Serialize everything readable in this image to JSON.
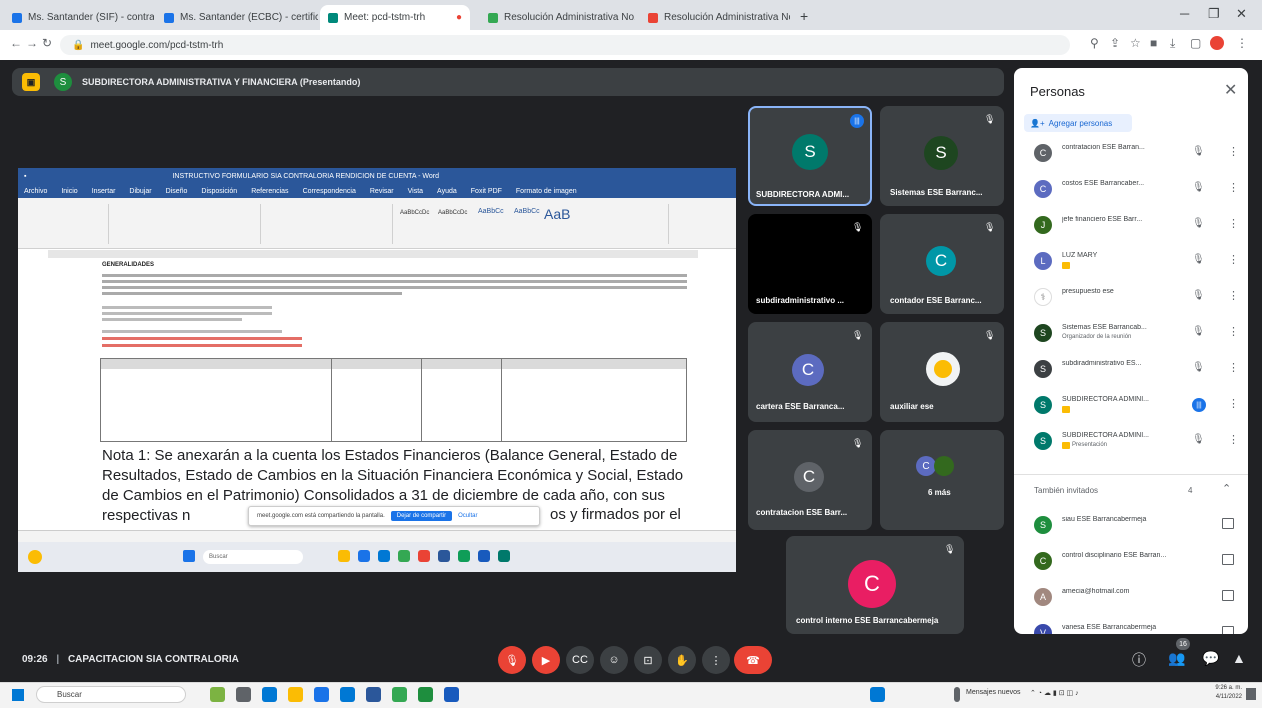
{
  "browser": {
    "tabs": [
      {
        "label": "Ms. Santander (SIF) - contralor..."
      },
      {
        "label": "Ms. Santander (ECBC) - certificado..."
      },
      {
        "label": "Meet: pcd-tstm-trh"
      },
      {
        "label": "Resolución Administrativa No..."
      },
      {
        "label": "Resolución Administrativa No..."
      }
    ],
    "url": "meet.google.com/pcd-tstm-trh"
  },
  "presentation": {
    "presenter": "SUBDIRECTORA ADMINISTRATIVA Y FINANCIERA (Presentando)"
  },
  "shared_doc": {
    "window_title": "INSTRUCTIVO FORMULARIO SIA CONTRALORIA RENDICION DE CUENTA - Word",
    "menu": [
      "Archivo",
      "Inicio",
      "Insertar",
      "Dibujar",
      "Diseño",
      "Disposición",
      "Referencias",
      "Correspondencia",
      "Revisar",
      "Vista",
      "Ayuda",
      "Foxit PDF",
      "Formato de imagen"
    ],
    "styles": [
      "AaBbCcDc",
      "AaBbCcDc",
      "AaBbCc",
      "AaBbCc",
      "AaB"
    ],
    "heading": "GENERALIDADES",
    "note": "Nota 1: Se anexarán a la cuenta los Estados Financieros (Balance General, Estado de Resultados, Estado de Cambios en la Situación Financiera Económica y Social, Estado de Cambios en el Patrimonio) Consolidados a 31 de diciembre de cada año, con sus respectivas n",
    "note_tail": "os y firmados por el",
    "share_banner": {
      "text": "meet.google.com está compartiendo la pantalla.",
      "stop": "Dejar de compartir",
      "hide": "Ocultar"
    },
    "taskbar_search": "Buscar"
  },
  "tiles": [
    {
      "name": "SUBDIRECTORA ADMI...",
      "initial": "S"
    },
    {
      "name": "Sistemas ESE Barranc...",
      "initial": "S"
    },
    {
      "name": "subdiradministrativo ...",
      "initial": ""
    },
    {
      "name": "contador ESE Barranc...",
      "initial": "C"
    },
    {
      "name": "cartera ESE Barranca...",
      "initial": "C"
    },
    {
      "name": "auxiliar ese",
      "initial": ""
    },
    {
      "name": "contratacion ESE Barr...",
      "initial": "C"
    },
    {
      "name": "6 más",
      "initial": "C"
    },
    {
      "name": "control interno ESE Barrancabermeja",
      "initial": "C"
    }
  ],
  "people": {
    "title": "Personas",
    "add_label": "Agregar personas",
    "rows": [
      {
        "name": "contratacion ESE Barran...",
        "initial": "C",
        "color": "#5f6368"
      },
      {
        "name": "costos ESE Barrancaber...",
        "initial": "C",
        "color": "#5c6bc0"
      },
      {
        "name": "jefe financiero ESE Barr...",
        "initial": "J",
        "color": "#33691e"
      },
      {
        "name": "LUZ MARY",
        "initial": "L",
        "color": "#5c6bc0"
      },
      {
        "name": "presupuesto ese",
        "initial": "",
        "color": "#ffffff"
      },
      {
        "name": "Sistemas ESE Barrancab...",
        "sub": "Organizador de la reunión",
        "initial": "S",
        "color": "#1e4620"
      },
      {
        "name": "subdiradministrativo ES...",
        "initial": "S",
        "color": "#3c4043"
      },
      {
        "name": "SUBDIRECTORA ADMINI...",
        "initial": "S",
        "color": "#00796b"
      },
      {
        "name": "SUBDIRECTORA ADMINI...",
        "sub": "Presentación",
        "initial": "S",
        "color": "#00796b"
      }
    ],
    "also_invited": "También invitados",
    "also_count": "4",
    "invited": [
      {
        "name": "siau ESE Barrancabermeja",
        "initial": "S",
        "color": "#1e8e3e"
      },
      {
        "name": "control disciplinario ESE Barran...",
        "initial": "C",
        "color": "#33691e"
      },
      {
        "name": "amecia@hotmail.com",
        "initial": "A",
        "color": "#a1887f"
      },
      {
        "name": "vanesa ESE Barrancabermeja",
        "initial": "V",
        "color": "#3949ab"
      }
    ]
  },
  "bottom": {
    "time": "09:26",
    "separator": "|",
    "meeting": "CAPACITACION SIA CONTRALORIA",
    "count": "16"
  },
  "taskbar": {
    "search": "Buscar",
    "tray_app": "Mensajes nuevos",
    "clock": "9:26 a. m.",
    "date": "4/11/2022"
  }
}
